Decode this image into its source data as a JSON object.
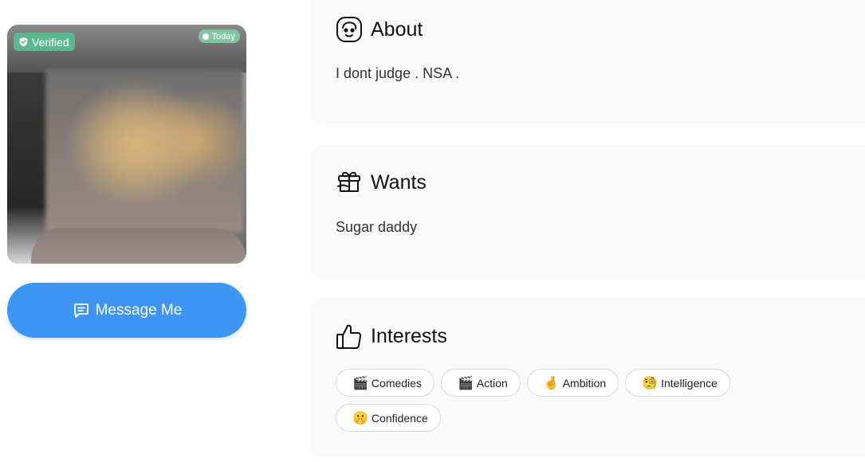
{
  "photo": {
    "verified_label": "Verified",
    "activity_label": "Today"
  },
  "message_button": {
    "label": "Message Me"
  },
  "about": {
    "title": "About",
    "text": "I dont judge . NSA ."
  },
  "wants": {
    "title": "Wants",
    "text": "Sugar daddy"
  },
  "interests": {
    "title": "Interests",
    "items": [
      {
        "emoji": "🎬",
        "label": "Comedies"
      },
      {
        "emoji": "🎬",
        "label": "Action"
      },
      {
        "emoji": "🤞",
        "label": "Ambition"
      },
      {
        "emoji": "🧐",
        "label": "Intelligence"
      },
      {
        "emoji": "🤫",
        "label": "Confidence"
      }
    ]
  },
  "colors": {
    "primary_button": "#3f95f2",
    "verified_badge": "#5cb890",
    "card_background": "#fafafa"
  }
}
